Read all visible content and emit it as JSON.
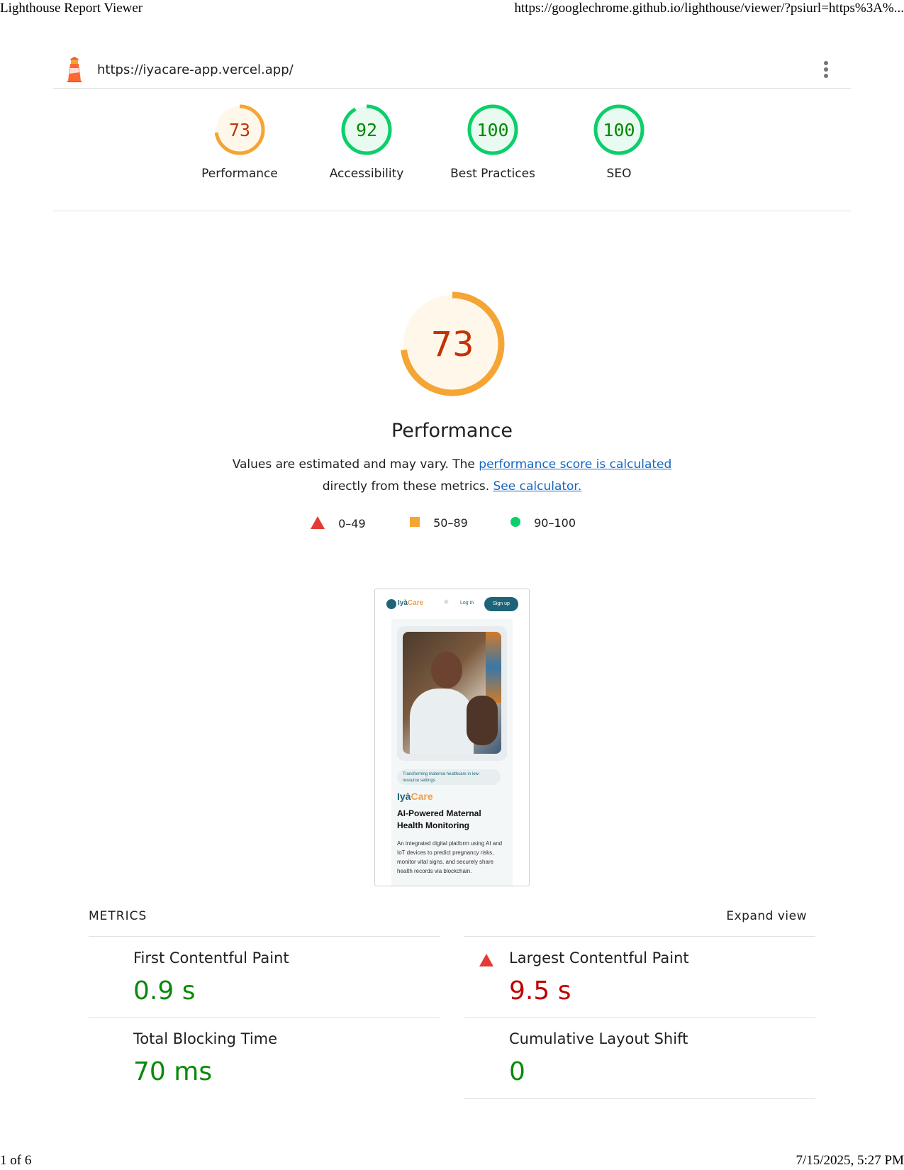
{
  "print_header": {
    "title": "Lighthouse Report Viewer",
    "url": "https://googlechrome.github.io/lighthouse/viewer/?psiurl=https%3A%..."
  },
  "print_footer": {
    "page": "1 of 6",
    "datetime": "7/15/2025, 5:27 PM"
  },
  "topbar": {
    "url": "https://iyacare-app.vercel.app/"
  },
  "colors": {
    "average": "#f4a533",
    "average_text": "#c33300",
    "average_fill": "#fff7ea",
    "pass": "#0cce6b",
    "pass_text": "#008800",
    "pass_fill": "#e9fbf1",
    "fail": "#e53935",
    "link": "#1565c0"
  },
  "gauges": [
    {
      "score": "73",
      "label": "Performance",
      "status": "average"
    },
    {
      "score": "92",
      "label": "Accessibility",
      "status": "pass"
    },
    {
      "score": "100",
      "label": "Best Practices",
      "status": "pass"
    },
    {
      "score": "100",
      "label": "SEO",
      "status": "pass"
    }
  ],
  "performance": {
    "score": "73",
    "title": "Performance",
    "desc_before": "Values are estimated and may vary. The ",
    "desc_link1": "performance score is calculated",
    "desc_middle": "directly from these metrics. ",
    "desc_link2": "See calculator.",
    "legend": {
      "fail": "0–49",
      "average": "50–89",
      "pass": "90–100"
    }
  },
  "screenshot": {
    "logo_prefix": "Iyà",
    "logo_suffix": "Care",
    "login": "Log in",
    "signup": "Sign up",
    "pill": "Transforming maternal healthcare in low-resource settings",
    "heading": "AI-Powered Maternal Health Monitoring",
    "paragraph": "An integrated digital platform using AI and IoT devices to predict pregnancy risks, monitor vital signs, and securely share health records via blockchain."
  },
  "metrics": {
    "title": "METRICS",
    "expand": "Expand view",
    "items": [
      {
        "name": "First Contentful Paint",
        "value": "0.9 s",
        "status": "pass"
      },
      {
        "name": "Largest Contentful Paint",
        "value": "9.5 s",
        "status": "fail"
      },
      {
        "name": "Total Blocking Time",
        "value": "70 ms",
        "status": "pass"
      },
      {
        "name": "Cumulative Layout Shift",
        "value": "0",
        "status": "pass"
      }
    ]
  }
}
